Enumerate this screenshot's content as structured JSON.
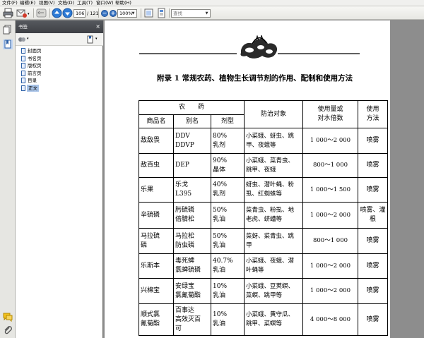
{
  "menu": {
    "items": [
      "文件(F)",
      "编辑(E)",
      "视图(V)",
      "文档(D)",
      "工具(T)",
      "窗口(W)",
      "帮助(H)"
    ]
  },
  "toolbar": {
    "page_current": "106",
    "page_total": "/ 121",
    "zoom": "100%",
    "find_placeholder": "查找"
  },
  "panel": {
    "title": "书签",
    "close": "×"
  },
  "bookmarks": [
    {
      "label": "封面页",
      "selected": false
    },
    {
      "label": "书名页",
      "selected": false
    },
    {
      "label": "版权页",
      "selected": false
    },
    {
      "label": "前言页",
      "selected": false
    },
    {
      "label": "目录",
      "selected": false
    },
    {
      "label": "正文",
      "selected": true
    }
  ],
  "document": {
    "appendix_title": "附录 1   常规农药、植物生长调节剂的作用、配制和使用方法",
    "table": {
      "headers": {
        "group": "农　　药",
        "name": "商品名",
        "alias": "别名",
        "form": "剂型",
        "target": "防治对象",
        "dosage": "使用量或\n对水倍数",
        "method": "使用\n方法"
      },
      "rows": [
        {
          "name": "敌敌畏",
          "alias": "DDV\nDDVP",
          "form": "80%\n乳剂",
          "target": "小菜蛾、蚜虫、跳\n甲、夜蛾等",
          "dosage": "1 000～2 000",
          "method": "喷雾"
        },
        {
          "name": "敌百虫",
          "alias": "DEP",
          "form": "90%\n晶体",
          "target": "小菜蛾、菜青虫、\n跳甲、夜蛾",
          "dosage": "800～1 000",
          "method": "喷雾"
        },
        {
          "name": "乐果",
          "alias": "乐戈\nL395",
          "form": "40%\n乳剂",
          "target": "蚜虫、潜叶蝇、粉\n虱、红蜘蛛等",
          "dosage": "1 000～1 500",
          "method": "喷雾"
        },
        {
          "name": "辛硫磷",
          "alias": "肟硫磷\n倍腈松",
          "form": "50%\n乳油",
          "target": "菜青虫、粉虱、地\n老虎、蛴螬等",
          "dosage": "1 000～2 000",
          "method": "喷雾、灌\n根"
        },
        {
          "name": "马拉硫\n磷",
          "alias": "马拉松\n防虫磷",
          "form": "50%\n乳油",
          "target": "菜蚜、菜青虫、跳\n甲",
          "dosage": "800～1 000",
          "method": "喷雾"
        },
        {
          "name": "乐斯本",
          "alias": "毒死蜱\n氯蜱硫磷",
          "form": "40.7%\n乳油",
          "target": "小菜蛾、夜蛾、潜\n叶蝇等",
          "dosage": "1 000～2 000",
          "method": "喷雾"
        },
        {
          "name": "兴棉宝",
          "alias": "安绿宝\n氯氰菊酯",
          "form": "10%\n乳油",
          "target": "小菜蛾、豆荚螟、\n菜螟、跳甲等",
          "dosage": "1 000～2 000",
          "method": "喷雾"
        },
        {
          "name": "顺式氯\n氰菊酯",
          "alias": "百事达\n高效灭百\n可",
          "form": "10%\n乳油",
          "target": "小菜蛾、黄守瓜、\n跳甲、菜螟等",
          "dosage": "4 000～8 000",
          "method": "喷雾"
        }
      ]
    }
  }
}
